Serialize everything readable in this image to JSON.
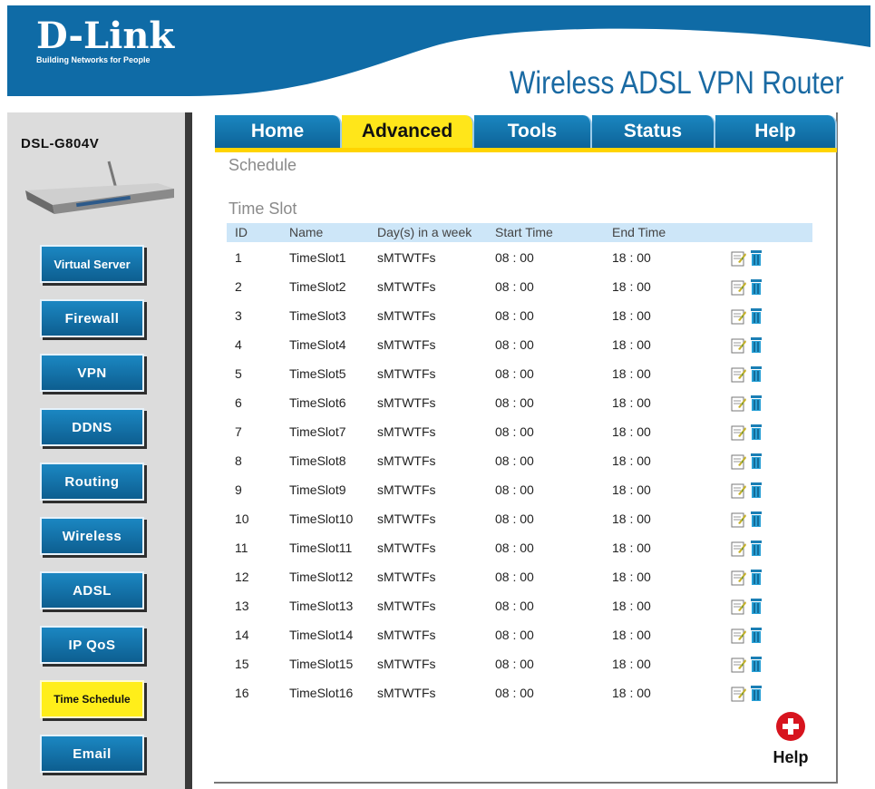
{
  "brand": {
    "logo": "D-Link",
    "tagline": "Building Networks for People",
    "product": "Wireless ADSL VPN Router"
  },
  "device": {
    "model": "DSL-G804V"
  },
  "colors": {
    "accent_blue": "#0f6ba6",
    "highlight_yellow": "#ffe61a",
    "table_header": "#cde6f8"
  },
  "tabs": [
    {
      "label": "Home",
      "active": false
    },
    {
      "label": "Advanced",
      "active": true
    },
    {
      "label": "Tools",
      "active": false
    },
    {
      "label": "Status",
      "active": false
    },
    {
      "label": "Help",
      "active": false
    }
  ],
  "sidebar": {
    "items": [
      {
        "label": "Virtual Server",
        "active": false
      },
      {
        "label": "Firewall",
        "active": false
      },
      {
        "label": "VPN",
        "active": false
      },
      {
        "label": "DDNS",
        "active": false
      },
      {
        "label": "Routing",
        "active": false
      },
      {
        "label": "Wireless",
        "active": false
      },
      {
        "label": "ADSL",
        "active": false
      },
      {
        "label": "IP QoS",
        "active": false
      },
      {
        "label": "Time Schedule",
        "active": true
      },
      {
        "label": "Email",
        "active": false
      }
    ]
  },
  "page": {
    "title": "Schedule",
    "section": "Time Slot"
  },
  "table": {
    "columns": [
      "ID",
      "Name",
      "Day(s) in a week",
      "Start Time",
      "End Time"
    ],
    "rows": [
      {
        "id": "1",
        "name": "TimeSlot1",
        "days": "sMTWTFs",
        "start": "08 : 00",
        "end": "18 : 00"
      },
      {
        "id": "2",
        "name": "TimeSlot2",
        "days": "sMTWTFs",
        "start": "08 : 00",
        "end": "18 : 00"
      },
      {
        "id": "3",
        "name": "TimeSlot3",
        "days": "sMTWTFs",
        "start": "08 : 00",
        "end": "18 : 00"
      },
      {
        "id": "4",
        "name": "TimeSlot4",
        "days": "sMTWTFs",
        "start": "08 : 00",
        "end": "18 : 00"
      },
      {
        "id": "5",
        "name": "TimeSlot5",
        "days": "sMTWTFs",
        "start": "08 : 00",
        "end": "18 : 00"
      },
      {
        "id": "6",
        "name": "TimeSlot6",
        "days": "sMTWTFs",
        "start": "08 : 00",
        "end": "18 : 00"
      },
      {
        "id": "7",
        "name": "TimeSlot7",
        "days": "sMTWTFs",
        "start": "08 : 00",
        "end": "18 : 00"
      },
      {
        "id": "8",
        "name": "TimeSlot8",
        "days": "sMTWTFs",
        "start": "08 : 00",
        "end": "18 : 00"
      },
      {
        "id": "9",
        "name": "TimeSlot9",
        "days": "sMTWTFs",
        "start": "08 : 00",
        "end": "18 : 00"
      },
      {
        "id": "10",
        "name": "TimeSlot10",
        "days": "sMTWTFs",
        "start": "08 : 00",
        "end": "18 : 00"
      },
      {
        "id": "11",
        "name": "TimeSlot11",
        "days": "sMTWTFs",
        "start": "08 : 00",
        "end": "18 : 00"
      },
      {
        "id": "12",
        "name": "TimeSlot12",
        "days": "sMTWTFs",
        "start": "08 : 00",
        "end": "18 : 00"
      },
      {
        "id": "13",
        "name": "TimeSlot13",
        "days": "sMTWTFs",
        "start": "08 : 00",
        "end": "18 : 00"
      },
      {
        "id": "14",
        "name": "TimeSlot14",
        "days": "sMTWTFs",
        "start": "08 : 00",
        "end": "18 : 00"
      },
      {
        "id": "15",
        "name": "TimeSlot15",
        "days": "sMTWTFs",
        "start": "08 : 00",
        "end": "18 : 00"
      },
      {
        "id": "16",
        "name": "TimeSlot16",
        "days": "sMTWTFs",
        "start": "08 : 00",
        "end": "18 : 00"
      }
    ],
    "row_icons": [
      "edit-icon",
      "trash-icon"
    ]
  },
  "help": {
    "label": "Help",
    "icon": "plus-circle-icon"
  }
}
